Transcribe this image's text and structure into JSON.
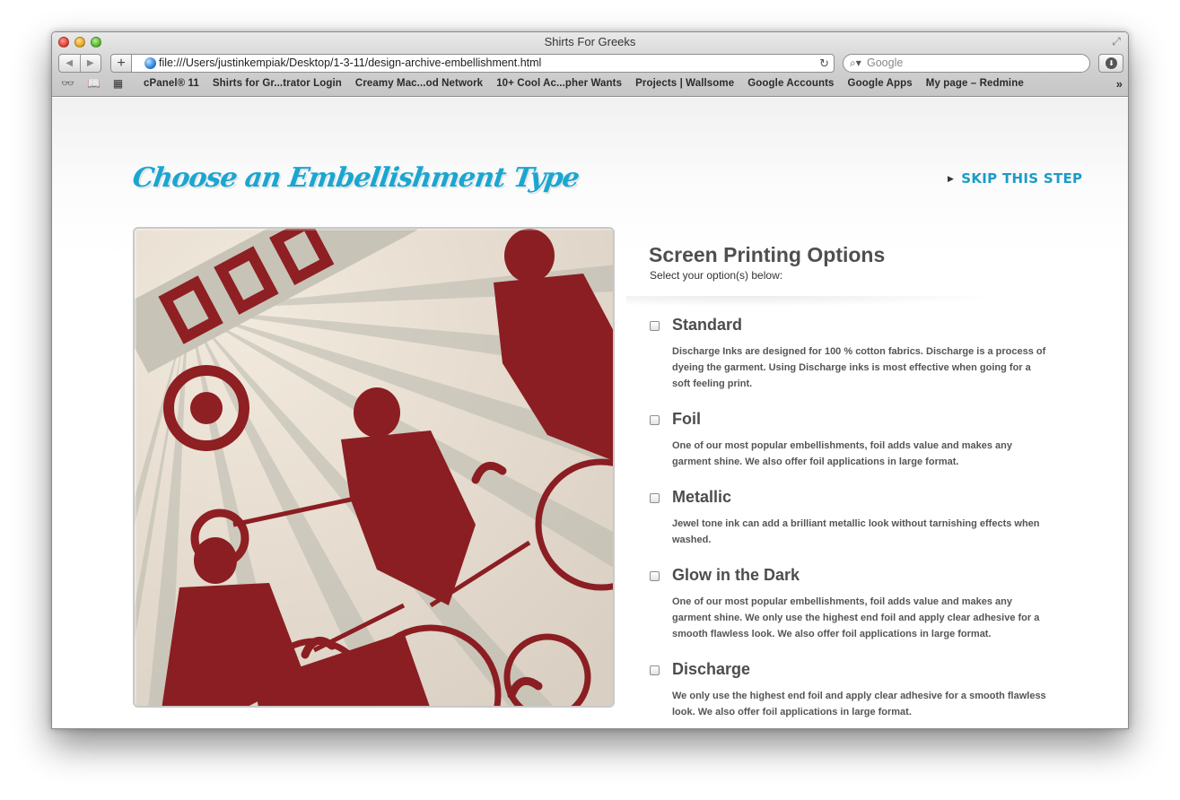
{
  "window": {
    "title": "Shirts For Greeks"
  },
  "toolbar": {
    "url": "file:///Users/justinkempiak/Desktop/1-3-11/design-archive-embellishment.html",
    "search_placeholder": "Google",
    "back_icon": "back-arrow-icon",
    "forward_icon": "forward-arrow-icon",
    "add_label": "+"
  },
  "bookmarks": [
    "cPanel® 11",
    "Shirts for Gr...trator Login",
    "Creamy Mac...od Network",
    "10+ Cool Ac...pher Wants",
    "Projects | Wallsome",
    "Google Accounts",
    "Google Apps",
    "My page – Redmine"
  ],
  "page": {
    "title": "Choose an Embellishment Type",
    "skip_label": "SKIP THIS STEP",
    "accent_color": "#1aa6d1"
  },
  "options": {
    "heading": "Screen Printing Options",
    "subheading": "Select your option(s) below:",
    "items": [
      {
        "name": "Standard",
        "description": "Discharge Inks are designed for 100 % cotton fabrics. Discharge is a process of dyeing the garment. Using Discharge inks is most effective when going for a soft feeling print."
      },
      {
        "name": "Foil",
        "description": "One of our most popular embellishments, foil adds value and makes any garment shine. We also offer foil applications in large format."
      },
      {
        "name": "Metallic",
        "description": "Jewel tone ink can add a brilliant metallic look without tarnishing effects when washed."
      },
      {
        "name": "Glow in the Dark",
        "description": "One of our most popular embellishments, foil adds value and makes any garment shine. We only use the highest end foil and apply clear adhesive for a smooth flawless look. We also offer foil applications in large format."
      },
      {
        "name": "Discharge",
        "description": "We only use the highest end foil and apply clear adhesive for a smooth flawless look. We also offer foil applications in large format."
      }
    ]
  }
}
